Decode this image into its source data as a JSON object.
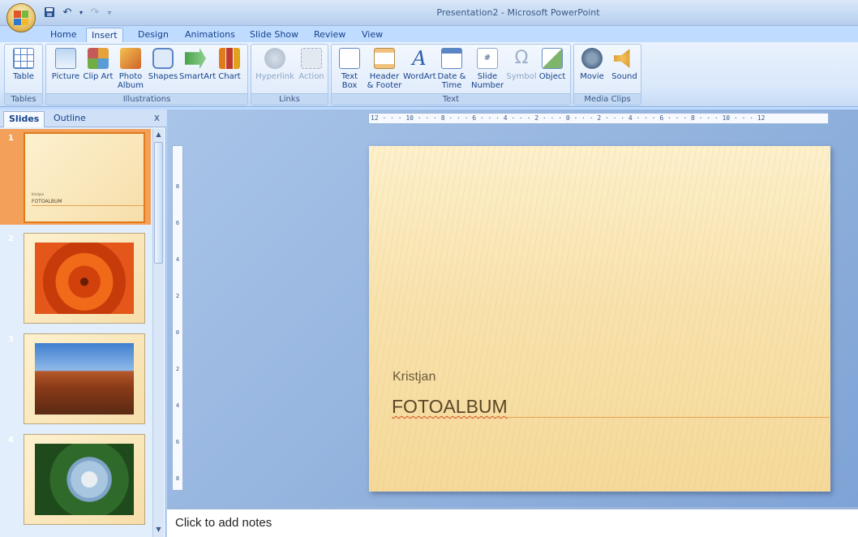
{
  "window": {
    "title": "Presentation2 - Microsoft PowerPoint"
  },
  "tabs": [
    {
      "label": "Home"
    },
    {
      "label": "Insert",
      "active": true
    },
    {
      "label": "Design"
    },
    {
      "label": "Animations"
    },
    {
      "label": "Slide Show"
    },
    {
      "label": "Review"
    },
    {
      "label": "View"
    }
  ],
  "ribbon": {
    "groups": [
      {
        "label": "Tables",
        "buttons": [
          {
            "label": "Table",
            "icon": "table-icon"
          }
        ]
      },
      {
        "label": "Illustrations",
        "buttons": [
          {
            "label": "Picture",
            "icon": "picture-icon"
          },
          {
            "label": "Clip Art",
            "icon": "clip-art-icon"
          },
          {
            "label": "Photo Album",
            "icon": "photo-album-icon"
          },
          {
            "label": "Shapes",
            "icon": "shapes-icon"
          },
          {
            "label": "SmartArt",
            "icon": "smartart-icon"
          },
          {
            "label": "Chart",
            "icon": "chart-icon"
          }
        ]
      },
      {
        "label": "Links",
        "buttons": [
          {
            "label": "Hyperlink",
            "icon": "hyperlink-icon",
            "disabled": true
          },
          {
            "label": "Action",
            "icon": "action-icon",
            "disabled": true
          }
        ]
      },
      {
        "label": "Text",
        "buttons": [
          {
            "label": "Text Box",
            "icon": "text-box-icon"
          },
          {
            "label": "Header & Footer",
            "icon": "header-footer-icon"
          },
          {
            "label": "WordArt",
            "icon": "wordart-icon"
          },
          {
            "label": "Date & Time",
            "icon": "date-time-icon"
          },
          {
            "label": "Slide Number",
            "icon": "slide-number-icon"
          },
          {
            "label": "Symbol",
            "icon": "symbol-icon",
            "disabled": true
          },
          {
            "label": "Object",
            "icon": "object-icon"
          }
        ]
      },
      {
        "label": "Media Clips",
        "buttons": [
          {
            "label": "Movie",
            "icon": "movie-icon"
          },
          {
            "label": "Sound",
            "icon": "sound-icon"
          }
        ]
      }
    ]
  },
  "panel": {
    "tabs": [
      {
        "label": "Slides",
        "active": true
      },
      {
        "label": "Outline"
      }
    ],
    "close": "x",
    "slides": [
      {
        "number": "1",
        "subtitle": "Kristjan",
        "title": "FOTOALBUM",
        "selected": true
      },
      {
        "number": "2",
        "image": "orange-flower-photo"
      },
      {
        "number": "3",
        "image": "desert-butte-photo"
      },
      {
        "number": "4",
        "image": "hydrangea-photo"
      }
    ]
  },
  "ruler": {
    "horizontal": "12 · · · 10 · · · 8 · · · 6 · · · 4 · · · 2 · · · 0 · · · 2 · · · 4 · · · 6 · · · 8 · · · 10 · · · 12",
    "vertical": [
      "8",
      "6",
      "4",
      "2",
      "0",
      "2",
      "4",
      "6",
      "8"
    ]
  },
  "slide": {
    "subtitle": "Kristjan",
    "title": "FOTOALBUM"
  },
  "notes": {
    "placeholder": "Click to add notes"
  },
  "colors": {
    "accent": "#15428b",
    "ribbon_bg": "#dae8fb",
    "selected_thumb": "#f3a15a",
    "slide_bg": "#f8e2ad"
  }
}
